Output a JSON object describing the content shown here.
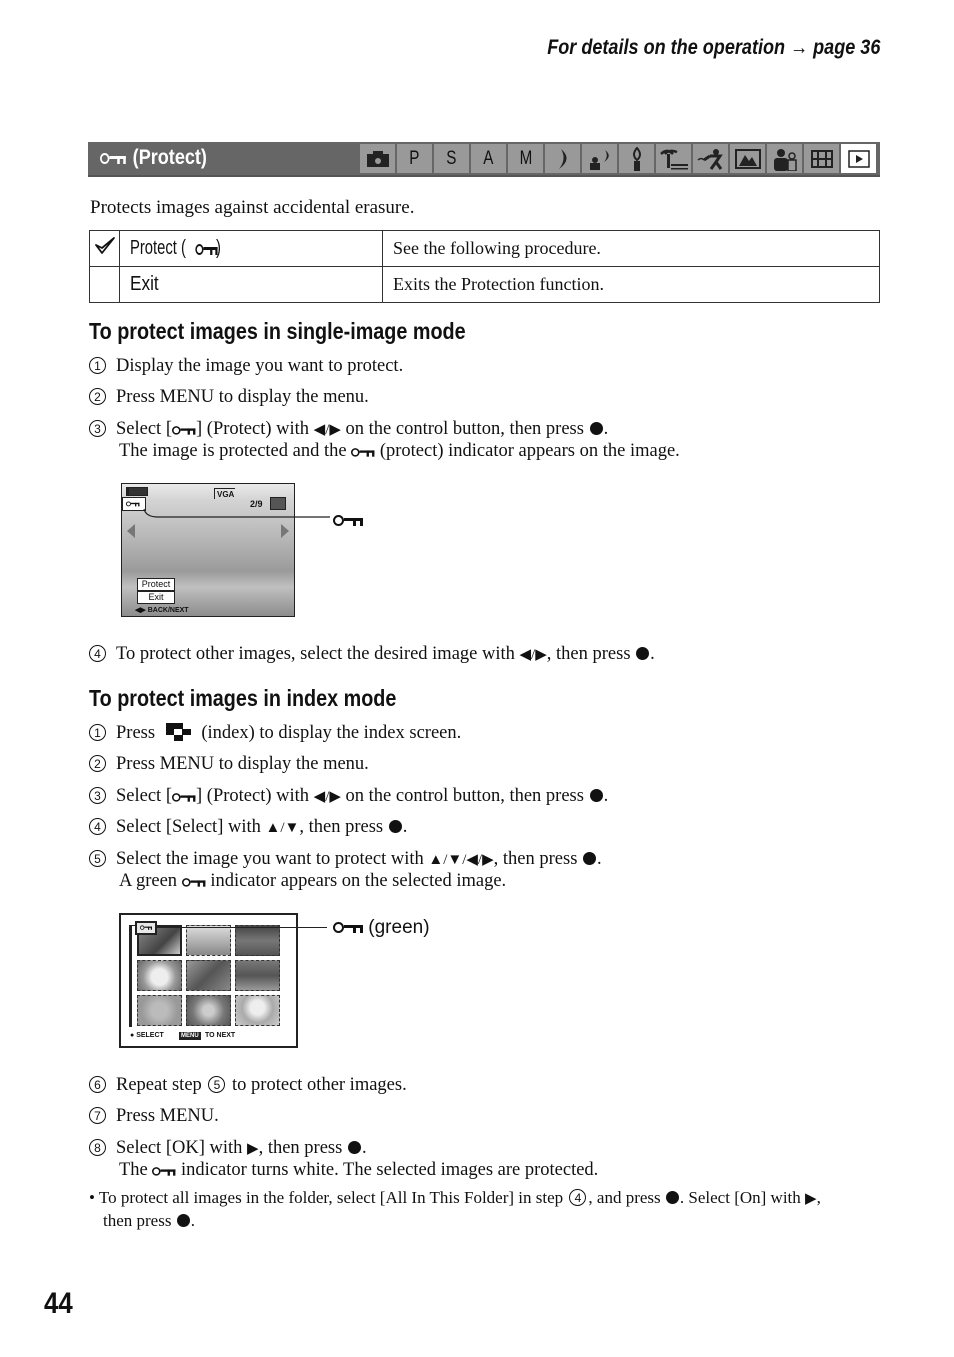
{
  "running_head": "For details on the operation → page 36",
  "section": {
    "title": "(Protect)",
    "icon": "protect-key-icon",
    "mode_icons": [
      {
        "name": "auto-camera-icon",
        "label": ""
      },
      {
        "name": "mode-p",
        "label": "P"
      },
      {
        "name": "mode-s",
        "label": "S"
      },
      {
        "name": "mode-a",
        "label": "A"
      },
      {
        "name": "mode-m",
        "label": "M"
      },
      {
        "name": "twilight-icon",
        "label": ""
      },
      {
        "name": "twilight-portrait-icon",
        "label": ""
      },
      {
        "name": "candle-icon",
        "label": ""
      },
      {
        "name": "beach-icon",
        "label": ""
      },
      {
        "name": "sports-icon",
        "label": ""
      },
      {
        "name": "landscape-icon",
        "label": ""
      },
      {
        "name": "portrait-icon",
        "label": ""
      },
      {
        "name": "movie-icon",
        "label": ""
      },
      {
        "name": "playback-icon",
        "label": "",
        "active": true
      }
    ]
  },
  "intro": "Protects images against accidental erasure.",
  "settings_table": {
    "rows": [
      {
        "selected": true,
        "option": "Protect (",
        "option_suffix": ")",
        "description": "See the following procedure."
      },
      {
        "selected": false,
        "option": "Exit",
        "description": "Exits the Protection function."
      }
    ]
  },
  "single_mode": {
    "heading": "To protect images in single-image mode",
    "steps": [
      {
        "n": "1",
        "text": "Display the image you want to protect."
      },
      {
        "n": "2",
        "text": "Press MENU to display the menu."
      },
      {
        "n": "3",
        "a": "Select [",
        "b": "] (Protect) with ",
        "arrows": "◀/▶",
        "c": " on the control button, then press ",
        "cont_a": "The image is protected and the ",
        "cont_b": " (protect) indicator appears on the image."
      },
      {
        "n": "4",
        "a": "To protect other images, select the desired image with ",
        "arrows": "◀/▶",
        "b": ", then press "
      }
    ],
    "screen": {
      "vga": "VGA",
      "counter": "2/9",
      "menu_items": [
        "Protect",
        "Exit"
      ],
      "footer": "BACK/NEXT",
      "footer_arrows": "◀▶"
    }
  },
  "index_mode": {
    "heading": "To protect images in index mode",
    "steps": [
      {
        "n": "1",
        "a": "Press ",
        "b": " (index) to display the index screen."
      },
      {
        "n": "2",
        "text": "Press MENU to display the menu."
      },
      {
        "n": "3",
        "a": "Select [",
        "b": "] (Protect) with ",
        "arrows": "◀/▶",
        "c": " on the control button, then press "
      },
      {
        "n": "4",
        "a": "Select [Select] with ",
        "arrows": "▲/▼",
        "b": ", then press "
      },
      {
        "n": "5",
        "a": "Select the image you want to protect with ",
        "arrows": "▲/▼/◀/▶",
        "b": ", then press ",
        "cont_a": "A green ",
        "cont_b": " indicator appears on the selected image."
      },
      {
        "n": "6",
        "a": "Repeat step ",
        "ref": "5",
        "b": " to protect other images."
      },
      {
        "n": "7",
        "text": "Press MENU."
      },
      {
        "n": "8",
        "a": "Select [OK] with ",
        "arrows": "▶",
        "b": ", then press ",
        "cont_a": "The ",
        "cont_b": " indicator turns white. The selected images are protected."
      }
    ],
    "screen": {
      "callout": "(green)",
      "footer_select": "SELECT",
      "footer_menu": "MENU",
      "footer_next": "TO NEXT"
    }
  },
  "note": {
    "a": "To protect all images in the folder, select [All In This Folder] in step ",
    "ref": "4",
    "b": ", and press ",
    "c": ". Select [On] with ",
    "arrows": "▶",
    "d": ",",
    "e": "then press "
  },
  "page_number": "44"
}
